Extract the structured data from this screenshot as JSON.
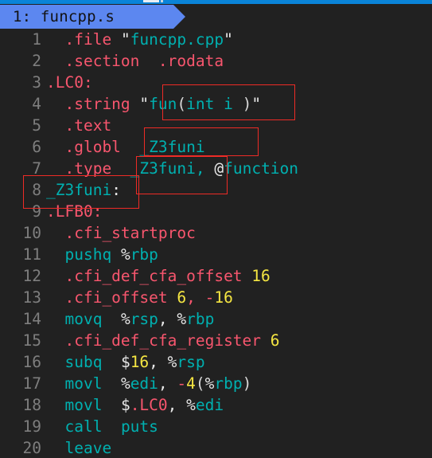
{
  "window": {
    "background_color": "#212121",
    "accent_color": "#0a84d8"
  },
  "tab": {
    "label": "1: funcpp.s",
    "index": "1",
    "filename": "funcpp.s",
    "background_color": "#5c87f0",
    "text_color": "#121212"
  },
  "editor": {
    "language": "assembly",
    "gutter_color": "#7e7e7e",
    "colors": {
      "directive": "#f8566e",
      "identifier": "#00b0b0",
      "number": "#f5e642",
      "punctuation": "#e8e8e8"
    },
    "lines": [
      {
        "number": "1",
        "tokens": [
          {
            "t": "\t",
            "c": "plain"
          },
          {
            "t": ".file",
            "c": "dir"
          },
          {
            "t": " ",
            "c": "plain"
          },
          {
            "t": "\"",
            "c": "pun"
          },
          {
            "t": "funcpp.cpp",
            "c": "ins"
          },
          {
            "t": "\"",
            "c": "pun"
          }
        ]
      },
      {
        "number": "2",
        "tokens": [
          {
            "t": "\t",
            "c": "plain"
          },
          {
            "t": ".section",
            "c": "dir"
          },
          {
            "t": "\t",
            "c": "plain"
          },
          {
            "t": ".rodata",
            "c": "dir"
          }
        ]
      },
      {
        "number": "3",
        "tokens": [
          {
            "t": ".LC0",
            "c": "dir"
          },
          {
            "t": ":",
            "c": "dir"
          }
        ]
      },
      {
        "number": "4",
        "tokens": [
          {
            "t": "\t",
            "c": "plain"
          },
          {
            "t": ".string",
            "c": "dir"
          },
          {
            "t": " ",
            "c": "plain"
          },
          {
            "t": "\"",
            "c": "pun"
          },
          {
            "t": "fun",
            "c": "ins"
          },
          {
            "t": "(",
            "c": "plain"
          },
          {
            "t": "int i ",
            "c": "ins"
          },
          {
            "t": ")",
            "c": "plain"
          },
          {
            "t": "\"",
            "c": "pun"
          }
        ]
      },
      {
        "number": "5",
        "tokens": [
          {
            "t": "\t",
            "c": "plain"
          },
          {
            "t": ".text",
            "c": "dir"
          }
        ]
      },
      {
        "number": "6",
        "tokens": [
          {
            "t": "\t",
            "c": "plain"
          },
          {
            "t": ".globl",
            "c": "dir"
          },
          {
            "t": "\t",
            "c": "plain"
          },
          {
            "t": "_Z3funi",
            "c": "ins"
          }
        ]
      },
      {
        "number": "7",
        "tokens": [
          {
            "t": "\t",
            "c": "plain"
          },
          {
            "t": ".type",
            "c": "dir"
          },
          {
            "t": "\t",
            "c": "plain"
          },
          {
            "t": "_Z3funi",
            "c": "ins"
          },
          {
            "t": ",",
            "c": "ins"
          },
          {
            "t": " ",
            "c": "plain"
          },
          {
            "t": "@",
            "c": "pun"
          },
          {
            "t": "function",
            "c": "ins"
          }
        ]
      },
      {
        "number": "8",
        "tokens": [
          {
            "t": "_Z3funi",
            "c": "ins"
          },
          {
            "t": ":",
            "c": "pun"
          }
        ]
      },
      {
        "number": "9",
        "tokens": [
          {
            "t": ".LFB0",
            "c": "dir"
          },
          {
            "t": ":",
            "c": "dir"
          }
        ]
      },
      {
        "number": "10",
        "tokens": [
          {
            "t": "\t",
            "c": "plain"
          },
          {
            "t": ".cfi_startproc",
            "c": "dir"
          }
        ]
      },
      {
        "number": "11",
        "tokens": [
          {
            "t": "\t",
            "c": "plain"
          },
          {
            "t": "pushq",
            "c": "ins"
          },
          {
            "t": " ",
            "c": "plain"
          },
          {
            "t": "%",
            "c": "pun"
          },
          {
            "t": "rbp",
            "c": "reg"
          }
        ]
      },
      {
        "number": "12",
        "tokens": [
          {
            "t": "\t",
            "c": "plain"
          },
          {
            "t": ".cfi_def_cfa_offset",
            "c": "dir"
          },
          {
            "t": " ",
            "c": "plain"
          },
          {
            "t": "16",
            "c": "num"
          }
        ]
      },
      {
        "number": "13",
        "tokens": [
          {
            "t": "\t",
            "c": "plain"
          },
          {
            "t": ".cfi_offset",
            "c": "dir"
          },
          {
            "t": " ",
            "c": "plain"
          },
          {
            "t": "6",
            "c": "num"
          },
          {
            "t": ",",
            "c": "dir"
          },
          {
            "t": " ",
            "c": "plain"
          },
          {
            "t": "-",
            "c": "dir"
          },
          {
            "t": "16",
            "c": "num"
          }
        ]
      },
      {
        "number": "14",
        "tokens": [
          {
            "t": "\t",
            "c": "plain"
          },
          {
            "t": "movq",
            "c": "ins"
          },
          {
            "t": "\t",
            "c": "plain"
          },
          {
            "t": "%",
            "c": "pun"
          },
          {
            "t": "rsp",
            "c": "reg"
          },
          {
            "t": ",",
            "c": "pun"
          },
          {
            "t": " ",
            "c": "plain"
          },
          {
            "t": "%",
            "c": "pun"
          },
          {
            "t": "rbp",
            "c": "reg"
          }
        ]
      },
      {
        "number": "15",
        "tokens": [
          {
            "t": "\t",
            "c": "plain"
          },
          {
            "t": ".cfi_def_cfa_register",
            "c": "dir"
          },
          {
            "t": " ",
            "c": "plain"
          },
          {
            "t": "6",
            "c": "num"
          }
        ]
      },
      {
        "number": "16",
        "tokens": [
          {
            "t": "\t",
            "c": "plain"
          },
          {
            "t": "subq",
            "c": "ins"
          },
          {
            "t": "\t",
            "c": "plain"
          },
          {
            "t": "$",
            "c": "pun"
          },
          {
            "t": "16",
            "c": "num"
          },
          {
            "t": ",",
            "c": "pun"
          },
          {
            "t": " ",
            "c": "plain"
          },
          {
            "t": "%",
            "c": "pun"
          },
          {
            "t": "rsp",
            "c": "reg"
          }
        ]
      },
      {
        "number": "17",
        "tokens": [
          {
            "t": "\t",
            "c": "plain"
          },
          {
            "t": "movl",
            "c": "ins"
          },
          {
            "t": "\t",
            "c": "plain"
          },
          {
            "t": "%",
            "c": "pun"
          },
          {
            "t": "edi",
            "c": "reg"
          },
          {
            "t": ",",
            "c": "pun"
          },
          {
            "t": " ",
            "c": "plain"
          },
          {
            "t": "-",
            "c": "dir"
          },
          {
            "t": "4",
            "c": "num"
          },
          {
            "t": "(",
            "c": "plain"
          },
          {
            "t": "%",
            "c": "pun"
          },
          {
            "t": "rbp",
            "c": "reg"
          },
          {
            "t": ")",
            "c": "plain"
          }
        ]
      },
      {
        "number": "18",
        "tokens": [
          {
            "t": "\t",
            "c": "plain"
          },
          {
            "t": "movl",
            "c": "ins"
          },
          {
            "t": "\t",
            "c": "plain"
          },
          {
            "t": "$",
            "c": "pun"
          },
          {
            "t": ".LC0",
            "c": "dir"
          },
          {
            "t": ",",
            "c": "pun"
          },
          {
            "t": " ",
            "c": "plain"
          },
          {
            "t": "%",
            "c": "pun"
          },
          {
            "t": "edi",
            "c": "reg"
          }
        ]
      },
      {
        "number": "19",
        "tokens": [
          {
            "t": "\t",
            "c": "plain"
          },
          {
            "t": "call",
            "c": "ins"
          },
          {
            "t": "\t",
            "c": "plain"
          },
          {
            "t": "puts",
            "c": "ins"
          }
        ]
      },
      {
        "number": "20",
        "tokens": [
          {
            "t": "\t",
            "c": "plain"
          },
          {
            "t": "leave",
            "c": "ins"
          }
        ]
      }
    ]
  },
  "annotations": {
    "color": "#ee2b26",
    "boxes": [
      {
        "id": "redbox-string",
        "covers": "\"fun(int i )"
      },
      {
        "id": "redbox-globl",
        "covers": "_Z3funi"
      },
      {
        "id": "redbox-type",
        "covers": "_Z3funi,"
      },
      {
        "id": "redbox-label",
        "covers": "8 _Z3funi:"
      }
    ]
  }
}
